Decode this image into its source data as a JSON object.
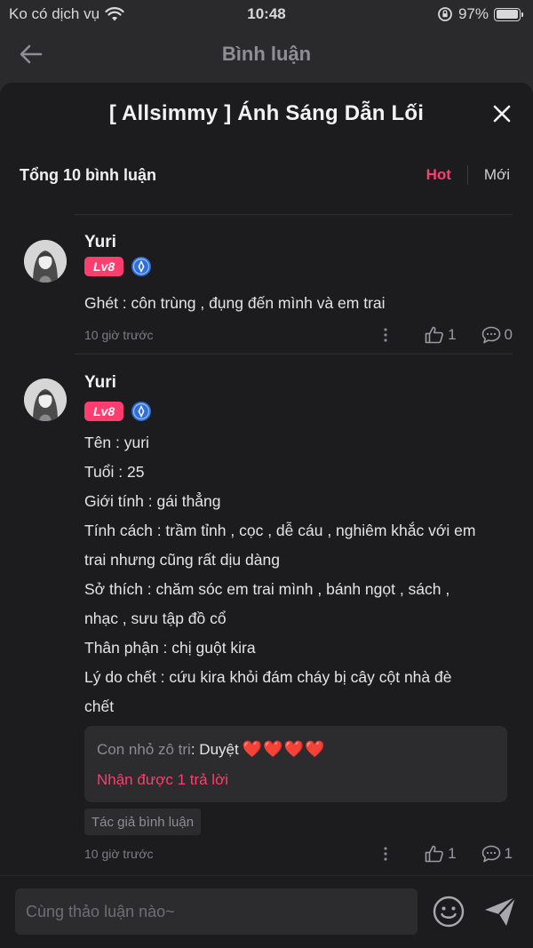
{
  "status_bar": {
    "carrier": "Ko có dịch vụ",
    "time": "10:48",
    "battery": "97%",
    "battery_level": 0.97
  },
  "nav": {
    "title": "Bình luận"
  },
  "sheet": {
    "title": "[ Allsimmy ] Ánh Sáng Dẫn Lối",
    "total": "Tổng 10 bình luận",
    "sort_hot": "Hot",
    "sort_new": "Mới"
  },
  "comments": [
    {
      "user": "Yuri",
      "level": "Lv8",
      "lines": [
        "Ghét : côn trùng , đụng đến mình và em trai"
      ],
      "time": "10 giờ trước",
      "likes": "1",
      "replies": "0"
    },
    {
      "user": "Yuri",
      "level": "Lv8",
      "lines": [
        "Tên : yuri",
        "Tuổi : 25",
        "Giới tính : gái thẳng",
        "Tính cách : trầm tỉnh , cọc , dễ cáu , nghiêm khắc với em",
        "trai nhưng cũng rất dịu dàng",
        "Sở thích : chăm sóc em trai mình , bánh ngọt , sách ,",
        "nhạc , sưu tập đồ cổ",
        "Thân phận : chị guột kira",
        "Lý do chết : cứu kira khỏi đám cháy bị cây cột nhà đè",
        "chết"
      ],
      "reply_author": "Con nhỏ zô tri",
      "reply_text": ": Duyệt",
      "reply_hearts": "❤️❤️❤️❤️",
      "reply_more": "Nhận được 1 trả lời",
      "author_tag": "Tác giả bình luận",
      "time": "10 giờ trước",
      "likes": "1",
      "replies": "1"
    }
  ],
  "input": {
    "placeholder": "Cùng thảo luận nào~"
  },
  "icons": {
    "back": "arrow-left-icon",
    "close": "close-icon",
    "wifi": "wifi-icon",
    "orientation_lock": "orientation-lock-icon",
    "verify": "verified-badge-icon",
    "more": "more-vertical-icon",
    "like": "thumbs-up-icon",
    "comment": "comment-bubble-icon",
    "emoji": "emoji-icon",
    "send": "send-icon"
  },
  "colors": {
    "accent": "#ff3d6e",
    "verify_blue": "#2f6fd6",
    "background": "#1c1c1e"
  }
}
